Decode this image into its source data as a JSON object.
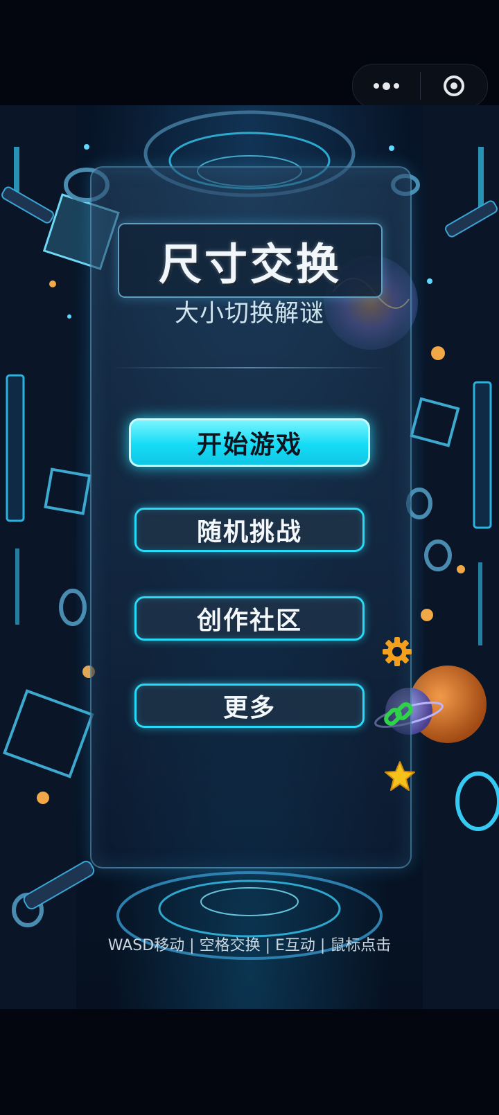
{
  "menu_capsule": {
    "more_icon": "more-dots-icon",
    "close_icon": "target-icon"
  },
  "game": {
    "title": "尺寸交换",
    "subtitle": "大小切换解谜",
    "buttons": [
      {
        "label": "开始游戏"
      },
      {
        "label": "随机挑战"
      },
      {
        "label": "创作社区"
      },
      {
        "label": "更多"
      }
    ],
    "side_icons": [
      "gear-icon",
      "link-icon",
      "star-icon"
    ],
    "controls_hint": "WASD移动 | 空格交换 | E互动 | 鼠标点击"
  },
  "colors": {
    "accent": "#29d9f5",
    "primary_button": "#14dcf5",
    "background": "#03060f",
    "gear": "#f2a01e",
    "link": "#2fd34a",
    "star": "#f5c21b"
  }
}
